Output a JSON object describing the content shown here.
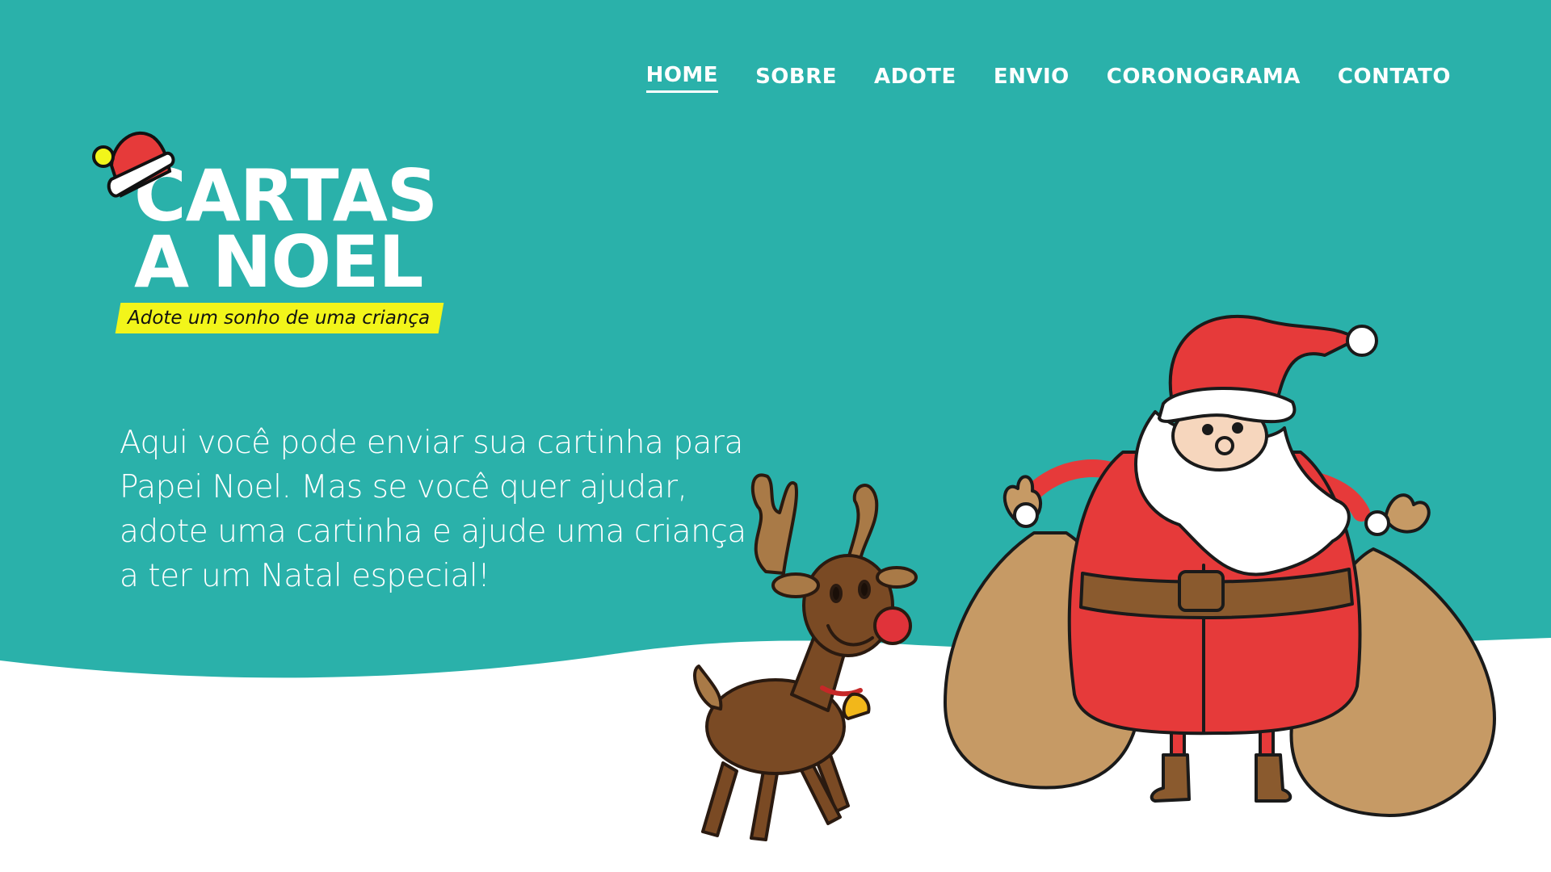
{
  "nav": {
    "items": [
      {
        "label": "HOME",
        "active": true
      },
      {
        "label": "SOBRE",
        "active": false
      },
      {
        "label": "ADOTE",
        "active": false
      },
      {
        "label": "ENVIO",
        "active": false
      },
      {
        "label": "CORONOGRAMA",
        "active": false
      },
      {
        "label": "CONTATO",
        "active": false
      }
    ]
  },
  "logo": {
    "line1": "CARTAS",
    "line2": "A NOEL",
    "tagline": "Adote um sonho de uma criança"
  },
  "hero": {
    "text": "Aqui você pode enviar sua cartinha para Papei Noel. Mas se você quer ajudar, adote uma cartinha e ajude uma criança a ter um Natal especial!"
  },
  "illustrations": {
    "reindeer": "reindeer-illustration",
    "santa": "santa-claus-illustration",
    "hat": "santa-hat-icon"
  },
  "colors": {
    "background": "#2ab1aa",
    "snow": "#ffffff",
    "tagline_highlight": "#f2f51a"
  }
}
